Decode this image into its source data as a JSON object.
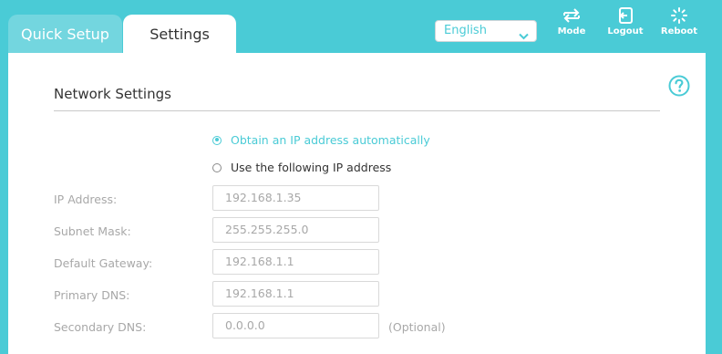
{
  "tabs": {
    "quick_setup": "Quick Setup",
    "settings": "Settings"
  },
  "language": {
    "selected": "English"
  },
  "toolbar": {
    "mode": "Mode",
    "logout": "Logout",
    "reboot": "Reboot"
  },
  "section": {
    "title": "Network Settings"
  },
  "ip_mode": {
    "auto_label": "Obtain an IP address automatically",
    "manual_label": "Use the following IP address",
    "selected": "auto"
  },
  "fields": [
    {
      "label": "IP Address:",
      "value": "192.168.1.35",
      "hint": ""
    },
    {
      "label": "Subnet Mask:",
      "value": "255.255.255.0",
      "hint": ""
    },
    {
      "label": "Default Gateway:",
      "value": "192.168.1.1",
      "hint": ""
    },
    {
      "label": "Primary DNS:",
      "value": "192.168.1.1",
      "hint": ""
    },
    {
      "label": "Secondary DNS:",
      "value": "0.0.0.0",
      "hint": "(Optional)"
    }
  ],
  "colors": {
    "accent": "#4acbd6",
    "tab_inactive": "#73d6df",
    "muted_text": "#a8a8a8"
  }
}
